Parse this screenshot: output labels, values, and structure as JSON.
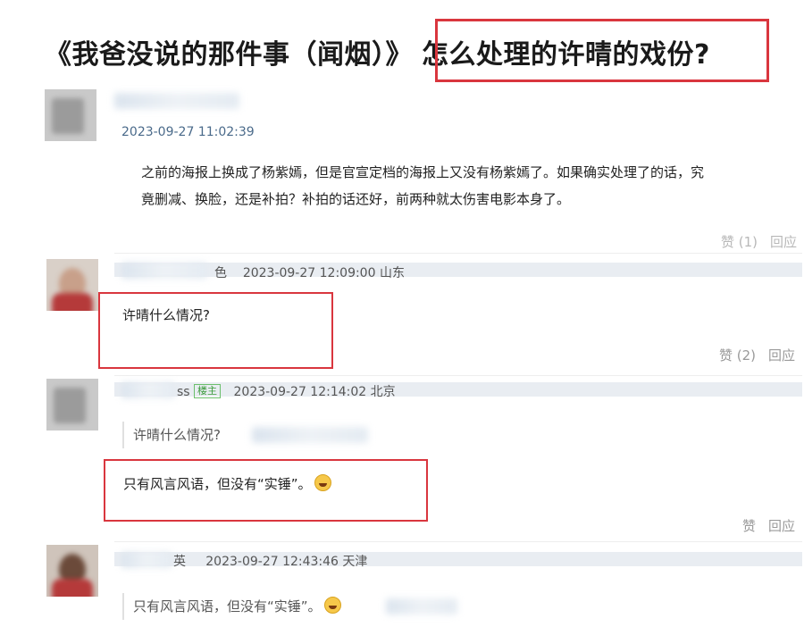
{
  "headline": {
    "left": "《我爸没说的那件事（闻烟）》",
    "highlight": "怎么处理的许晴的戏份?"
  },
  "comments": [
    {
      "timestamp": "2023-09-27 11:02:39",
      "text_line1": "之前的海报上换成了杨紫嫣，但是官宣定档的海报上又没有杨紫嫣了。如果确实处理了的话，究",
      "text_line2": "竟删减、换脸，还是补拍？补拍的话还好，前两种就太伤害电影本身了。",
      "actions": {
        "like": "赞 (1)",
        "reply": "回应"
      }
    },
    {
      "name_suffix": "色",
      "timestamp": "2023-09-27 12:09:00",
      "location": "山东",
      "text": "许晴什么情况?",
      "actions": {
        "like": "赞 (2)",
        "reply": "回应"
      }
    },
    {
      "name_suffix": "ss",
      "tag": "楼主",
      "timestamp": "2023-09-27 12:14:02",
      "location": "北京",
      "quote": "许晴什么情况?",
      "text": "只有风言风语，但没有“实锤”。",
      "actions": {
        "like": "赞",
        "reply": "回应"
      }
    },
    {
      "name_suffix": "英",
      "timestamp": "2023-09-27 12:43:46",
      "location": "天津",
      "quote": "只有风言风语，但没有“实锤”。"
    }
  ],
  "icons": {
    "emoji": "grinning-face-icon"
  },
  "colors": {
    "highlight_border": "#d9363e",
    "tag_green": "#3a9a3a"
  }
}
